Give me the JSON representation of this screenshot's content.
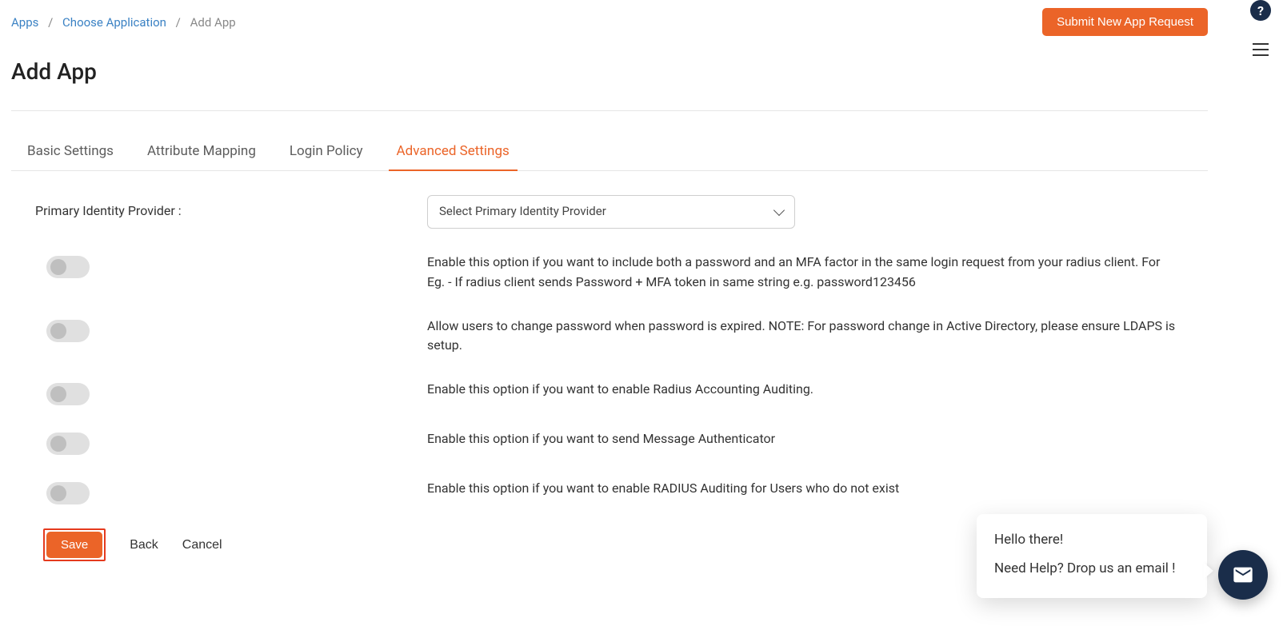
{
  "breadcrumb": {
    "items": [
      "Apps",
      "Choose Application",
      "Add App"
    ]
  },
  "header": {
    "submit_button": "Submit New App Request",
    "page_title": "Add App"
  },
  "tabs": [
    {
      "label": "Basic Settings",
      "active": false
    },
    {
      "label": "Attribute Mapping",
      "active": false
    },
    {
      "label": "Login Policy",
      "active": false
    },
    {
      "label": "Advanced Settings",
      "active": true
    }
  ],
  "form": {
    "idp_label": "Primary Identity Provider :",
    "idp_placeholder": "Select Primary Identity Provider",
    "options": [
      {
        "desc": "Enable this option if you want to include both a password and an MFA factor in the same login request from your radius client. For Eg. - If radius client sends Password + MFA token in same string e.g. password123456"
      },
      {
        "desc": "Allow users to change password when password is expired. NOTE: For password change in Active Directory, please ensure LDAPS is setup."
      },
      {
        "desc": "Enable this option if you want to enable Radius Accounting Auditing."
      },
      {
        "desc": "Enable this option if you want to send Message Authenticator"
      },
      {
        "desc": "Enable this option if you want to enable RADIUS Auditing for Users who do not exist"
      }
    ]
  },
  "footer": {
    "save": "Save",
    "back": "Back",
    "cancel": "Cancel"
  },
  "chat": {
    "title": "Hello there!",
    "body": "Need Help? Drop us an email !"
  }
}
